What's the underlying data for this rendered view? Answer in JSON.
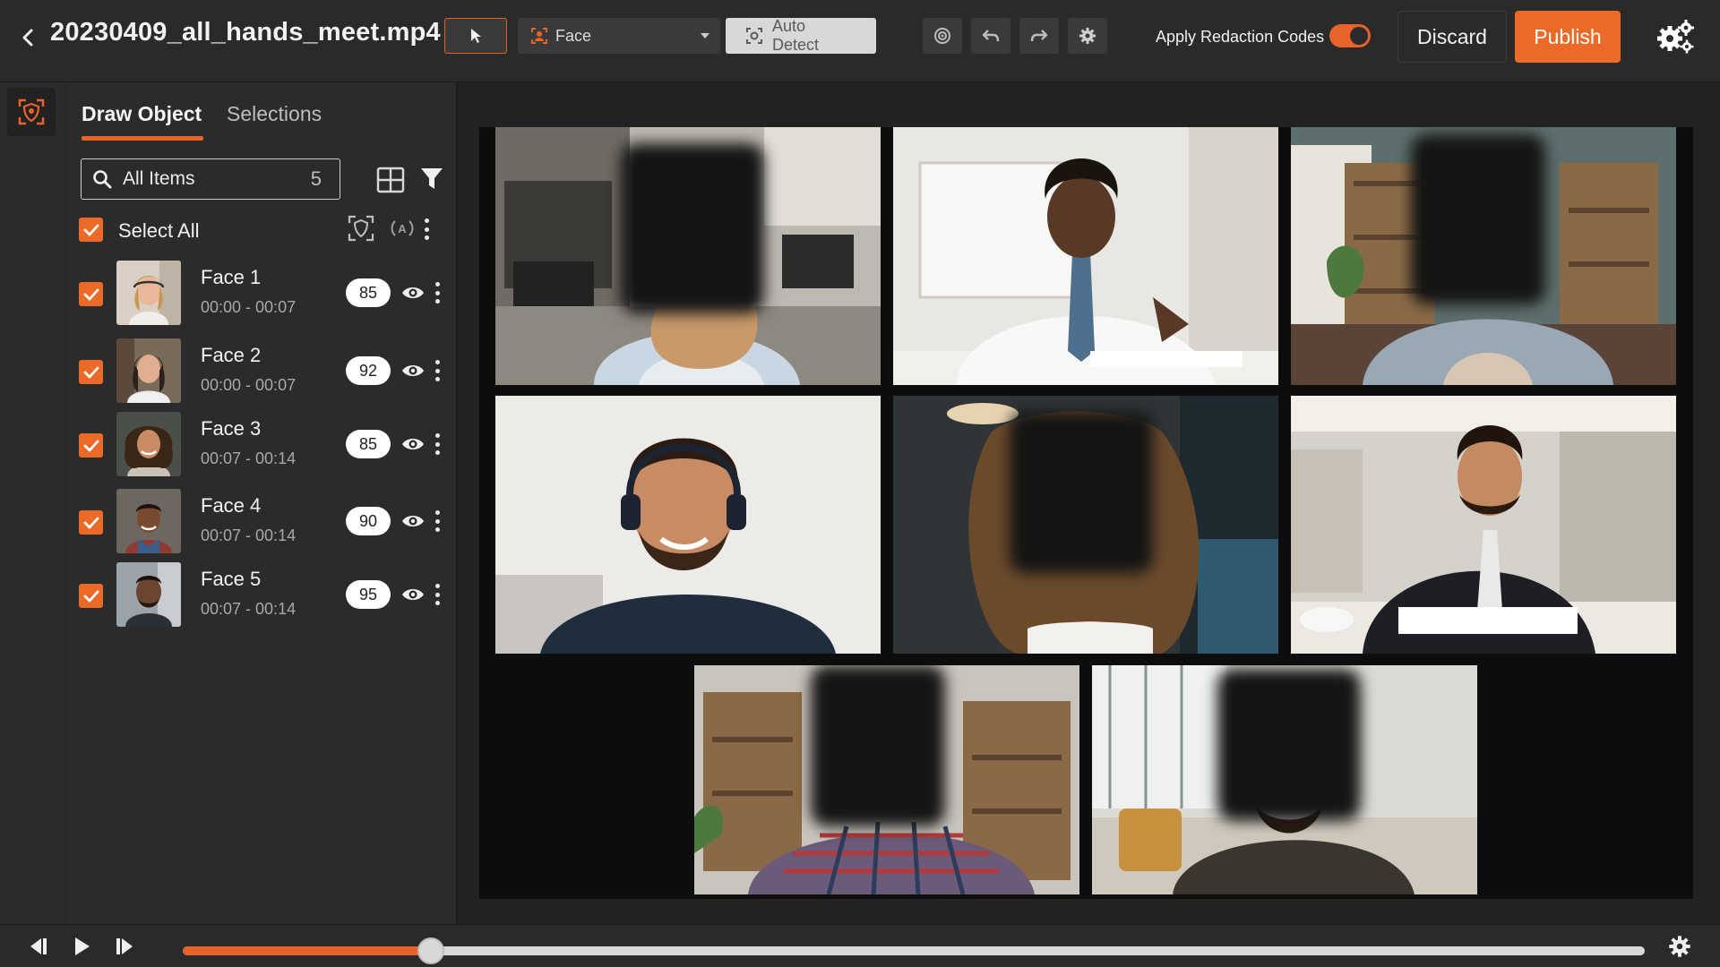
{
  "header": {
    "file_title": "20230409_all_hands_meet.mp4",
    "object_type": "Face",
    "auto_detect_label": "Auto Detect",
    "redaction_label": "Apply Redaction Codes",
    "redaction_enabled": true,
    "discard_label": "Discard",
    "publish_label": "Publish"
  },
  "panel": {
    "tabs": [
      {
        "label": "Draw Object",
        "active": true
      },
      {
        "label": "Selections",
        "active": false
      }
    ],
    "search": {
      "placeholder": "All Items",
      "count": "5"
    },
    "select_all_label": "Select All",
    "items": [
      {
        "name": "Face 1",
        "time": "00:00 - 00:07",
        "score": "85",
        "checked": true
      },
      {
        "name": "Face 2",
        "time": "00:00 - 00:07",
        "score": "92",
        "checked": true
      },
      {
        "name": "Face 3",
        "time": "00:07 - 00:14",
        "score": "85",
        "checked": true
      },
      {
        "name": "Face 4",
        "time": "00:07 - 00:14",
        "score": "90",
        "checked": true
      },
      {
        "name": "Face 5",
        "time": "00:07 - 00:14",
        "score": "95",
        "checked": true
      }
    ]
  },
  "player": {
    "progress_fraction": 0.17
  },
  "colors": {
    "accent": "#EC6A28",
    "background": "#2A2A2A",
    "panel": "#2B2B2B"
  },
  "icons": {
    "back": "chevron-left-icon",
    "pointer": "cursor-arrow-icon",
    "face": "face-scan-icon",
    "target": "target-icon",
    "undo": "undo-icon",
    "redo": "redo-icon",
    "gear": "gear-icon",
    "settings": "settings-cogs-icon",
    "grid": "grid-icon",
    "filter": "filter-icon",
    "eye": "eye-icon"
  }
}
